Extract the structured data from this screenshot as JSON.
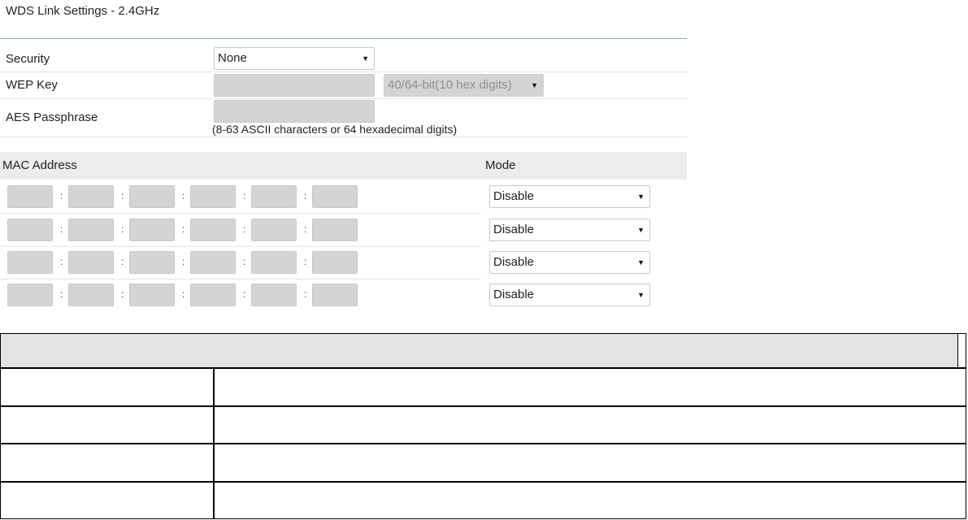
{
  "title": "WDS Link Settings - 2.4GHz",
  "security": {
    "label": "Security",
    "value": "None"
  },
  "wep_key": {
    "label": "WEP Key",
    "value": "",
    "key_length": "40/64-bit(10 hex digits)"
  },
  "aes": {
    "label": "AES Passphrase",
    "value": "",
    "hint": "(8-63 ASCII characters or 64 hexadecimal digits)"
  },
  "mac_table": {
    "mac_header": "MAC Address",
    "mode_header": "Mode",
    "separator": ":",
    "rows": [
      {
        "octets": [
          "",
          "",
          "",
          "",
          "",
          ""
        ],
        "mode": "Disable"
      },
      {
        "octets": [
          "",
          "",
          "",
          "",
          "",
          ""
        ],
        "mode": "Disable"
      },
      {
        "octets": [
          "",
          "",
          "",
          "",
          "",
          ""
        ],
        "mode": "Disable"
      },
      {
        "octets": [
          "",
          "",
          "",
          "",
          "",
          ""
        ],
        "mode": "Disable"
      }
    ]
  },
  "colors": {
    "title_rule": "#8fa9bd",
    "input_fill": "#d4d4d4",
    "header_band": "#ececec"
  }
}
